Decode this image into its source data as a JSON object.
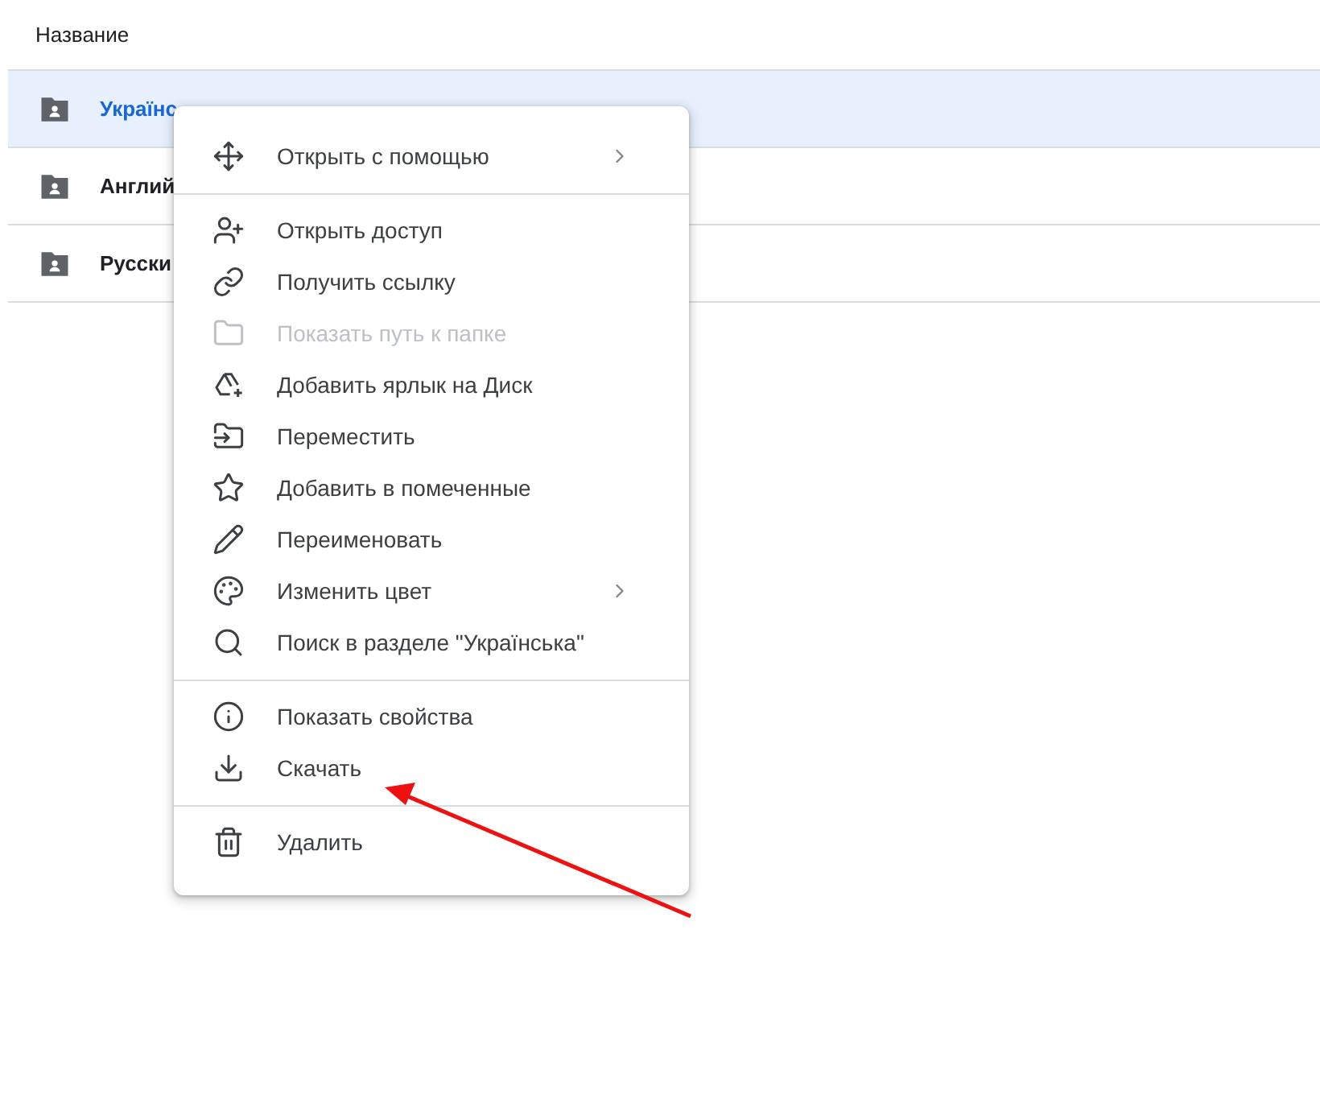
{
  "table": {
    "column_header": "Название",
    "rows": [
      {
        "name": "Українс",
        "selected": true
      },
      {
        "name": "Англий",
        "selected": false
      },
      {
        "name": "Русски",
        "selected": false
      }
    ]
  },
  "context_menu": {
    "groups": [
      [
        {
          "label": "Открыть с помощью",
          "has_submenu": true,
          "disabled": false
        }
      ],
      [
        {
          "label": "Открыть доступ",
          "has_submenu": false,
          "disabled": false
        },
        {
          "label": "Получить ссылку",
          "has_submenu": false,
          "disabled": false
        },
        {
          "label": "Показать путь к папке",
          "has_submenu": false,
          "disabled": true
        },
        {
          "label": "Добавить ярлык на Диск",
          "has_submenu": false,
          "disabled": false
        },
        {
          "label": "Переместить",
          "has_submenu": false,
          "disabled": false
        },
        {
          "label": "Добавить в помеченные",
          "has_submenu": false,
          "disabled": false
        },
        {
          "label": "Переименовать",
          "has_submenu": false,
          "disabled": false
        },
        {
          "label": "Изменить цвет",
          "has_submenu": true,
          "disabled": false
        },
        {
          "label": "Поиск в разделе \"Українська\"",
          "has_submenu": false,
          "disabled": false
        }
      ],
      [
        {
          "label": "Показать свойства",
          "has_submenu": false,
          "disabled": false
        },
        {
          "label": "Скачать",
          "has_submenu": false,
          "disabled": false
        }
      ],
      [
        {
          "label": "Удалить",
          "has_submenu": false,
          "disabled": false
        }
      ]
    ]
  }
}
